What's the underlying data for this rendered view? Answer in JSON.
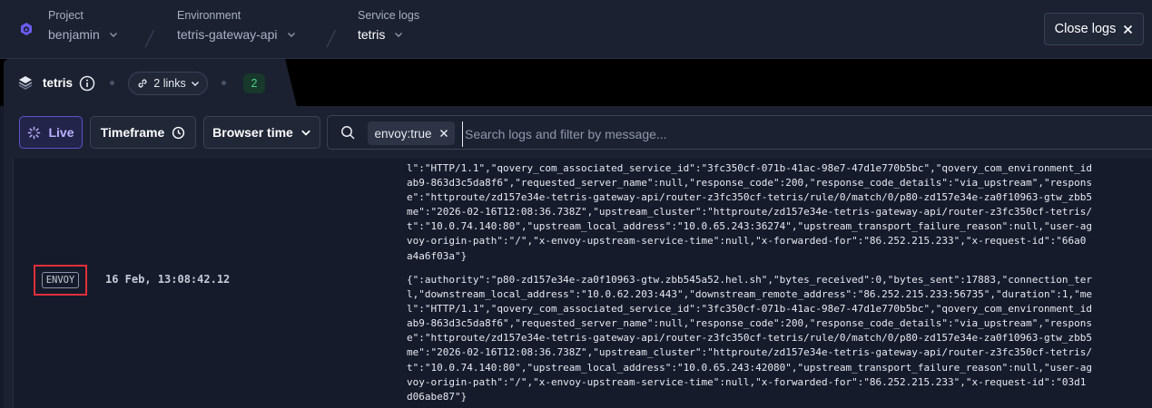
{
  "header": {
    "breadcrumbs": [
      {
        "label": "Project",
        "value": "benjamin"
      },
      {
        "label": "Environment",
        "value": "tetris-gateway-api"
      },
      {
        "label": "Service logs",
        "value": "tetris"
      }
    ],
    "close_label": "Close logs"
  },
  "tab": {
    "name": "tetris",
    "links_label": "2 links",
    "count": "2"
  },
  "toolbar": {
    "live_label": "Live",
    "timeframe_label": "Timeframe",
    "browser_time_label": "Browser time",
    "filter_chip": "envoy:true",
    "search_placeholder": "Search logs and filter by message..."
  },
  "logs": {
    "entry1_lines": [
      "l\":\"HTTP/1.1\",\"qovery_com_associated_service_id\":\"3fc350cf-071b-41ac-98e7-47d1e770b5bc\",\"qovery_com_environment_id",
      "ab9-863d3c5da8f6\",\"requested_server_name\":null,\"response_code\":200,\"response_code_details\":\"via_upstream\",\"respons",
      "e\":\"httproute/zd157e34e-tetris-gateway-api/router-z3fc350cf-tetris/rule/0/match/0/p80-zd157e34e-za0f10963-gtw_zbb5",
      "me\":\"2026-02-16T12:08:36.738Z\",\"upstream_cluster\":\"httproute/zd157e34e-tetris-gateway-api/router-z3fc350cf-tetris/",
      "t\":\"10.0.74.140:80\",\"upstream_local_address\":\"10.0.65.243:36274\",\"upstream_transport_failure_reason\":null,\"user-ag",
      "voy-origin-path\":\"/\",\"x-envoy-upstream-service-time\":null,\"x-forwarded-for\":\"86.252.215.233\",\"x-request-id\":\"66a0",
      "a4a6f03a\"}"
    ],
    "entry2": {
      "source": "ENVOY",
      "timestamp": "16 Feb, 13:08:42.12",
      "lines": [
        "{\":authority\":\"p80-zd157e34e-za0f10963-gtw.zbb545a52.hel.sh\",\"bytes_received\":0,\"bytes_sent\":17883,\"connection_ter",
        "l,\"downstream_local_address\":\"10.0.62.203:443\",\"downstream_remote_address\":\"86.252.215.233:56735\",\"duration\":1,\"me",
        "l\":\"HTTP/1.1\",\"qovery_com_associated_service_id\":\"3fc350cf-071b-41ac-98e7-47d1e770b5bc\",\"qovery_com_environment_id",
        "ab9-863d3c5da8f6\",\"requested_server_name\":null,\"response_code\":200,\"response_code_details\":\"via_upstream\",\"respons",
        "e\":\"httproute/zd157e34e-tetris-gateway-api/router-z3fc350cf-tetris/rule/0/match/0/p80-zd157e34e-za0f10963-gtw_zbb5",
        "me\":\"2026-02-16T12:08:36.738Z\",\"upstream_cluster\":\"httproute/zd157e34e-tetris-gateway-api/router-z3fc350cf-tetris/",
        "t\":\"10.0.74.140:80\",\"upstream_local_address\":\"10.0.65.243:42080\",\"upstream_transport_failure_reason\":null,\"user-ag",
        "voy-origin-path\":\"/\",\"x-envoy-upstream-service-time\":null,\"x-forwarded-for\":\"86.252.215.233\",\"x-request-id\":\"03d1",
        "d06abe87\"}"
      ]
    }
  },
  "colors": {
    "background": "#151b2b",
    "panel": "#1b2130",
    "accent": "#5b53c9",
    "highlight": "#e0303a",
    "count_green": "#4bd18a"
  }
}
